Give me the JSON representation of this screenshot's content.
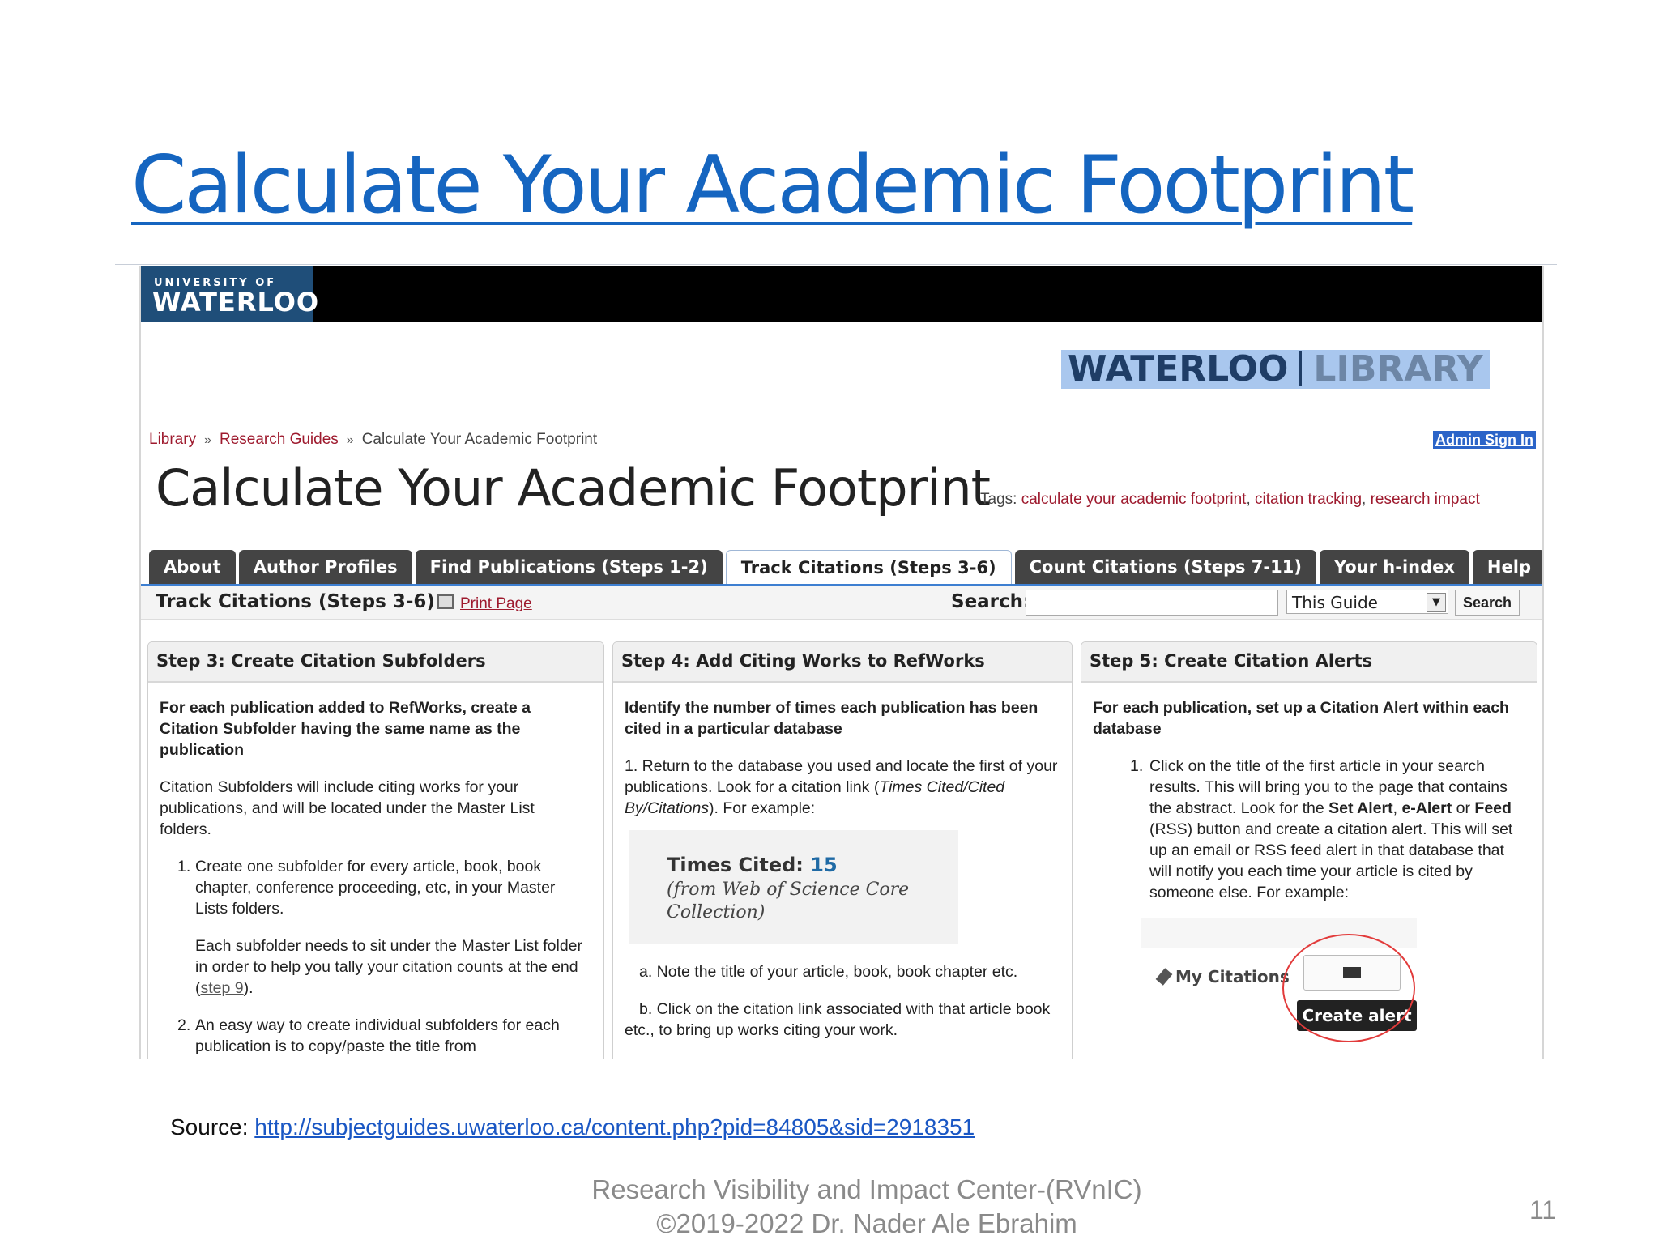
{
  "slide": {
    "title": "Calculate Your Academic Footprint",
    "source_label": "Source:",
    "source_url": "http://subjectguides.uwaterloo.ca/content.php?pid=84805&sid=2918351",
    "footer_line1": "Research Visibility and Impact Center-(RVnIC)",
    "footer_line2": "©2019-2022 Dr. Nader Ale Ebrahim",
    "page_number": "11"
  },
  "site": {
    "uw_logo_top": "UNIVERSITY OF",
    "uw_logo_main": "WATERLOO",
    "library_logo_left": "WATERLOO",
    "library_logo_right": "LIBRARY",
    "breadcrumb": [
      "Library",
      "Research Guides",
      "Calculate Your Academic Footprint"
    ],
    "breadcrumb_sep": "»",
    "admin_sign_in": "Admin Sign In",
    "guide_title": "Calculate Your Academic Footprint",
    "tags_label": "Tags:",
    "tags": [
      "calculate your academic footprint",
      "citation tracking",
      "research impact"
    ],
    "tabs": [
      "About",
      "Author Profiles",
      "Find Publications (Steps 1-2)",
      "Track Citations (Steps 3-6)",
      "Count Citations (Steps 7-11)",
      "Your h-index",
      "Help"
    ],
    "active_tab": "Track Citations (Steps 3-6)",
    "page_name": "Track Citations (Steps 3-6)",
    "print_page": "Print Page",
    "search_label": "Search:",
    "search_value": "",
    "search_scope": "This Guide",
    "search_button": "Search"
  },
  "columns": {
    "step3": {
      "heading": "Step 3: Create Citation Subfolders",
      "lead_pre": "For ",
      "lead_u": "each publication",
      "lead_post": " added to RefWorks, create a Citation Subfolder having the same name as the publication",
      "p1": "Citation Subfolders will include citing works for your publications, and will be located under the Master List folders.",
      "item1_num": "1.",
      "item1": "Create one subfolder for every article, book, book chapter, conference proceeding, etc, in your Master Lists folders.",
      "item1b_pre": "Each subfolder needs to sit under the Master List folder in order to help you tally your citation counts at the end (",
      "item1b_link": "step 9",
      "item1b_post": ").",
      "item2_num": "2.",
      "item2": "An easy way to create individual subfolders for each publication is to copy/paste the title from"
    },
    "step4": {
      "heading": "Step 4: Add Citing Works to RefWorks",
      "lead_pre": "Identify the number of times ",
      "lead_u": "each publication",
      "lead_post": " has been cited in a particular database",
      "p1_pre": "1. Return to the database you used and locate the first of your publications. Look for a citation link (",
      "p1_em": "Times Cited/Cited By/Citations",
      "p1_post": "). For example:",
      "times_cited_label": "Times Cited:",
      "times_cited_value": "15",
      "times_cited_source": "(from Web of Science Core Collection)",
      "a": "a. Note the title of your article, book, book chapter etc.",
      "b": "b. Click on the citation link associated with that article book etc., to bring up works citing your work."
    },
    "step5": {
      "heading": "Step 5: Create Citation Alerts",
      "lead_pre": "For ",
      "lead_u1": "each publication",
      "lead_mid": ", set up a Citation Alert within ",
      "lead_u2": "each database",
      "item1_num": "1.",
      "item1_pre": "Click on the title of the first article in your search results. This will bring you to the page that contains the abstract.  Look for the ",
      "item1_b1": "Set Alert",
      "item1_c": ", ",
      "item1_b2": "e-Alert",
      "item1_or": " or ",
      "item1_b3": "Feed",
      "item1_post": " (RSS) button and create a citation alert. This will set up an email or RSS feed alert in that database that will notify you each time your article is cited by someone else. For example:",
      "my_citations": "My Citations",
      "create_alert": "Create alert"
    }
  },
  "colors": {
    "title_blue": "#1565c0",
    "link_red": "#9e1a2e",
    "uw_blue": "#1f4e79",
    "tab_dark": "#444444",
    "tab_rule": "#3e7fd1"
  }
}
